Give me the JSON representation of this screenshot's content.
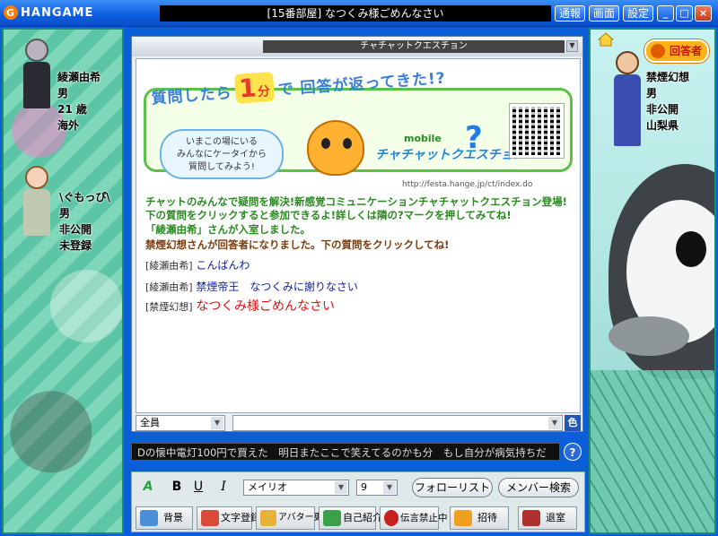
{
  "app": {
    "logo_text": "HANGAME",
    "room_title": "[15番部屋] なつくみ様ごめんなさい"
  },
  "titlebar": {
    "buttons": [
      "通報",
      "画面",
      "設定"
    ],
    "minimize": "_",
    "maximize": "□",
    "close": "×"
  },
  "left_users": [
    {
      "name": "綾瀬由希",
      "gender": "男",
      "age": "21 歳",
      "region": "海外"
    },
    {
      "name": "\\ぐもっぴ\\",
      "gender": "男",
      "age": "非公開",
      "region": "未登録"
    }
  ],
  "right_user": {
    "name": "禁煙幻想",
    "gender": "男",
    "age": "非公開",
    "region": "山梨県"
  },
  "answer_badge": "回答者",
  "channel": {
    "title": "チャチャットクエスチョン",
    "collapse": "▼"
  },
  "banner": {
    "headline_pre": "質問したら",
    "headline_num": "1",
    "headline_unit": "分",
    "headline_post": "で 回答が返ってきた!?",
    "bubble": "いまこの場にいる\nみんなにケータイから\n質問してみよう!",
    "mobile": "mobile",
    "logo": "チャチャットクエスチョン",
    "url": "http://festa.hange.jp/ct/index.do"
  },
  "messages": {
    "system1": "チャットのみんなで疑問を解決!新感覚コミュニケーションチャチャットクエスチョン登場!下の質問をクリックすると参加できるよ!詳しくは隣の?マークを押してみてね!",
    "system2": "「綾瀬由希」さんが入室しました。",
    "system3": "禁煙幻想さんが回答者になりました。下の質問をクリックしてね!",
    "chat": [
      {
        "speaker": "[綾瀬由希]",
        "text": "こんばんわ"
      },
      {
        "speaker": "[綾瀬由希]",
        "text": "禁煙帝王　なつくみに謝りなさい"
      },
      {
        "speaker": "[禁煙幻想]",
        "text": "なつくみ様ごめんなさい"
      }
    ]
  },
  "input": {
    "target": "全員",
    "text": "",
    "color_btn": "色",
    "arrow": "▼"
  },
  "ticker": "Dの懐中電灯100円で買えた　明日またここで笑えてるのかも分　もし自分が病気持ちだ",
  "help_btn": "?",
  "toolbar": {
    "bold": "B",
    "underline": "U",
    "italic": "I",
    "font": "メイリオ",
    "size": "9",
    "follow_list": "フォローリスト",
    "member_search": "メンバー検索",
    "actions": [
      "背景",
      "文字登録",
      "アバター更新",
      "自己紹介",
      "伝言禁止中",
      "招待",
      "退室"
    ]
  },
  "colors": {
    "titlebar": "#0b5ee0",
    "system_text": "#2a8a20",
    "chat_blue": "#1020a0",
    "chat_red": "#e01010",
    "badge": "#ffb21a"
  }
}
